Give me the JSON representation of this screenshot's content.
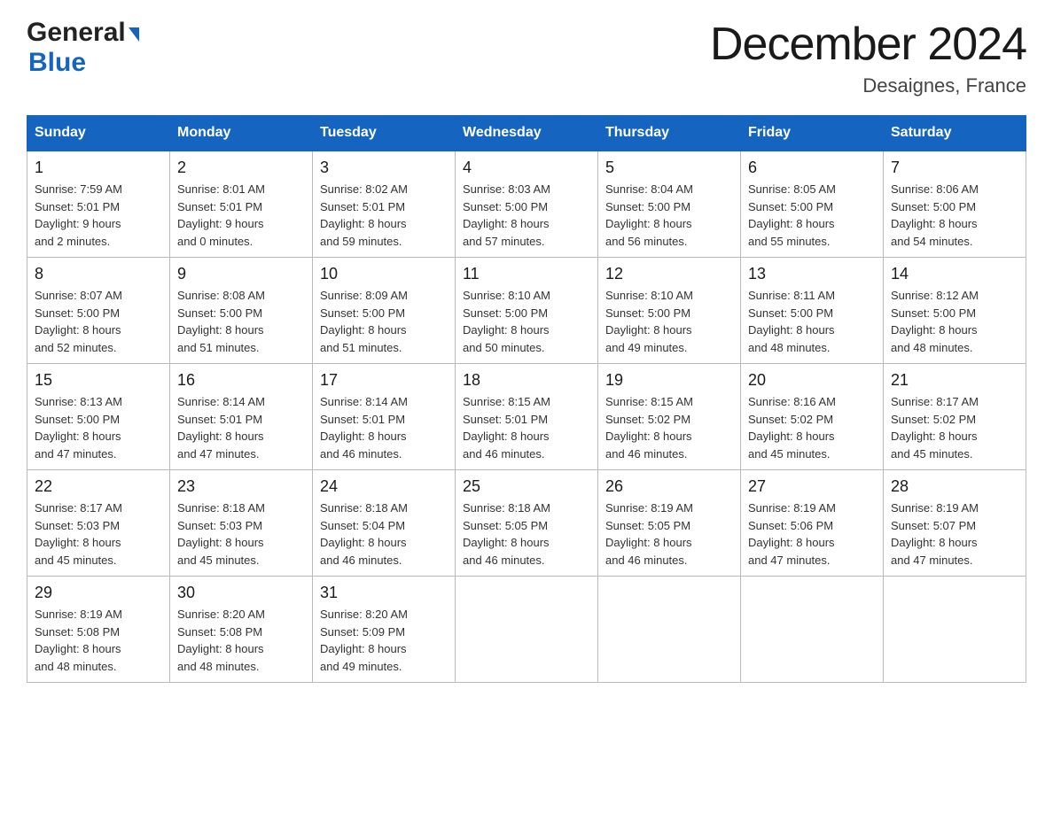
{
  "header": {
    "logo_line1": "General",
    "logo_line2": "Blue",
    "calendar_title": "December 2024",
    "calendar_subtitle": "Desaignes, France"
  },
  "days_of_week": [
    "Sunday",
    "Monday",
    "Tuesday",
    "Wednesday",
    "Thursday",
    "Friday",
    "Saturday"
  ],
  "weeks": [
    [
      {
        "day": "1",
        "sunrise": "7:59 AM",
        "sunset": "5:01 PM",
        "daylight": "9 hours and 2 minutes."
      },
      {
        "day": "2",
        "sunrise": "8:01 AM",
        "sunset": "5:01 PM",
        "daylight": "9 hours and 0 minutes."
      },
      {
        "day": "3",
        "sunrise": "8:02 AM",
        "sunset": "5:01 PM",
        "daylight": "8 hours and 59 minutes."
      },
      {
        "day": "4",
        "sunrise": "8:03 AM",
        "sunset": "5:00 PM",
        "daylight": "8 hours and 57 minutes."
      },
      {
        "day": "5",
        "sunrise": "8:04 AM",
        "sunset": "5:00 PM",
        "daylight": "8 hours and 56 minutes."
      },
      {
        "day": "6",
        "sunrise": "8:05 AM",
        "sunset": "5:00 PM",
        "daylight": "8 hours and 55 minutes."
      },
      {
        "day": "7",
        "sunrise": "8:06 AM",
        "sunset": "5:00 PM",
        "daylight": "8 hours and 54 minutes."
      }
    ],
    [
      {
        "day": "8",
        "sunrise": "8:07 AM",
        "sunset": "5:00 PM",
        "daylight": "8 hours and 52 minutes."
      },
      {
        "day": "9",
        "sunrise": "8:08 AM",
        "sunset": "5:00 PM",
        "daylight": "8 hours and 51 minutes."
      },
      {
        "day": "10",
        "sunrise": "8:09 AM",
        "sunset": "5:00 PM",
        "daylight": "8 hours and 51 minutes."
      },
      {
        "day": "11",
        "sunrise": "8:10 AM",
        "sunset": "5:00 PM",
        "daylight": "8 hours and 50 minutes."
      },
      {
        "day": "12",
        "sunrise": "8:10 AM",
        "sunset": "5:00 PM",
        "daylight": "8 hours and 49 minutes."
      },
      {
        "day": "13",
        "sunrise": "8:11 AM",
        "sunset": "5:00 PM",
        "daylight": "8 hours and 48 minutes."
      },
      {
        "day": "14",
        "sunrise": "8:12 AM",
        "sunset": "5:00 PM",
        "daylight": "8 hours and 48 minutes."
      }
    ],
    [
      {
        "day": "15",
        "sunrise": "8:13 AM",
        "sunset": "5:00 PM",
        "daylight": "8 hours and 47 minutes."
      },
      {
        "day": "16",
        "sunrise": "8:14 AM",
        "sunset": "5:01 PM",
        "daylight": "8 hours and 47 minutes."
      },
      {
        "day": "17",
        "sunrise": "8:14 AM",
        "sunset": "5:01 PM",
        "daylight": "8 hours and 46 minutes."
      },
      {
        "day": "18",
        "sunrise": "8:15 AM",
        "sunset": "5:01 PM",
        "daylight": "8 hours and 46 minutes."
      },
      {
        "day": "19",
        "sunrise": "8:15 AM",
        "sunset": "5:02 PM",
        "daylight": "8 hours and 46 minutes."
      },
      {
        "day": "20",
        "sunrise": "8:16 AM",
        "sunset": "5:02 PM",
        "daylight": "8 hours and 45 minutes."
      },
      {
        "day": "21",
        "sunrise": "8:17 AM",
        "sunset": "5:02 PM",
        "daylight": "8 hours and 45 minutes."
      }
    ],
    [
      {
        "day": "22",
        "sunrise": "8:17 AM",
        "sunset": "5:03 PM",
        "daylight": "8 hours and 45 minutes."
      },
      {
        "day": "23",
        "sunrise": "8:18 AM",
        "sunset": "5:03 PM",
        "daylight": "8 hours and 45 minutes."
      },
      {
        "day": "24",
        "sunrise": "8:18 AM",
        "sunset": "5:04 PM",
        "daylight": "8 hours and 46 minutes."
      },
      {
        "day": "25",
        "sunrise": "8:18 AM",
        "sunset": "5:05 PM",
        "daylight": "8 hours and 46 minutes."
      },
      {
        "day": "26",
        "sunrise": "8:19 AM",
        "sunset": "5:05 PM",
        "daylight": "8 hours and 46 minutes."
      },
      {
        "day": "27",
        "sunrise": "8:19 AM",
        "sunset": "5:06 PM",
        "daylight": "8 hours and 47 minutes."
      },
      {
        "day": "28",
        "sunrise": "8:19 AM",
        "sunset": "5:07 PM",
        "daylight": "8 hours and 47 minutes."
      }
    ],
    [
      {
        "day": "29",
        "sunrise": "8:19 AM",
        "sunset": "5:08 PM",
        "daylight": "8 hours and 48 minutes."
      },
      {
        "day": "30",
        "sunrise": "8:20 AM",
        "sunset": "5:08 PM",
        "daylight": "8 hours and 48 minutes."
      },
      {
        "day": "31",
        "sunrise": "8:20 AM",
        "sunset": "5:09 PM",
        "daylight": "8 hours and 49 minutes."
      },
      null,
      null,
      null,
      null
    ]
  ]
}
